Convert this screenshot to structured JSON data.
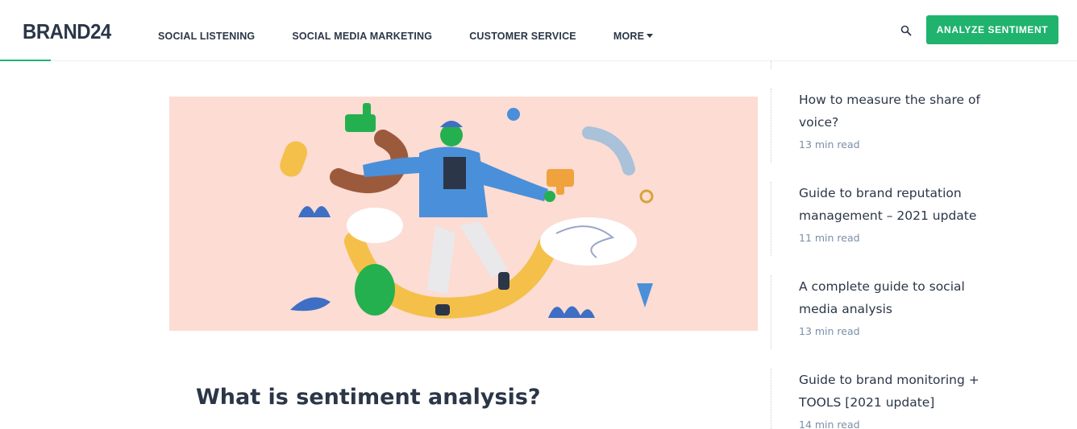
{
  "header": {
    "logo": "BRAND24",
    "nav": [
      {
        "label": "SOCIAL LISTENING"
      },
      {
        "label": "SOCIAL MEDIA MARKETING"
      },
      {
        "label": "CUSTOMER SERVICE"
      },
      {
        "label": "MORE"
      }
    ],
    "search_icon": "search-icon",
    "cta_label": "ANALYZE SENTIMENT"
  },
  "colors": {
    "accent": "#1fb36e",
    "text": "#2b3648",
    "hero_bg": "#fcdcd3",
    "meta": "#7a8fa8"
  },
  "article": {
    "heading": "What is sentiment analysis?"
  },
  "sidebar": {
    "items": [
      {
        "title": "How to measure the share of voice?",
        "meta": "13 min read"
      },
      {
        "title": "Guide to brand reputation management – 2021 update",
        "meta": "11 min read"
      },
      {
        "title": "A complete guide to social media analysis",
        "meta": "13 min read"
      },
      {
        "title": "Guide to brand monitoring + TOOLS [2021 update]",
        "meta": "14 min read"
      }
    ]
  }
}
